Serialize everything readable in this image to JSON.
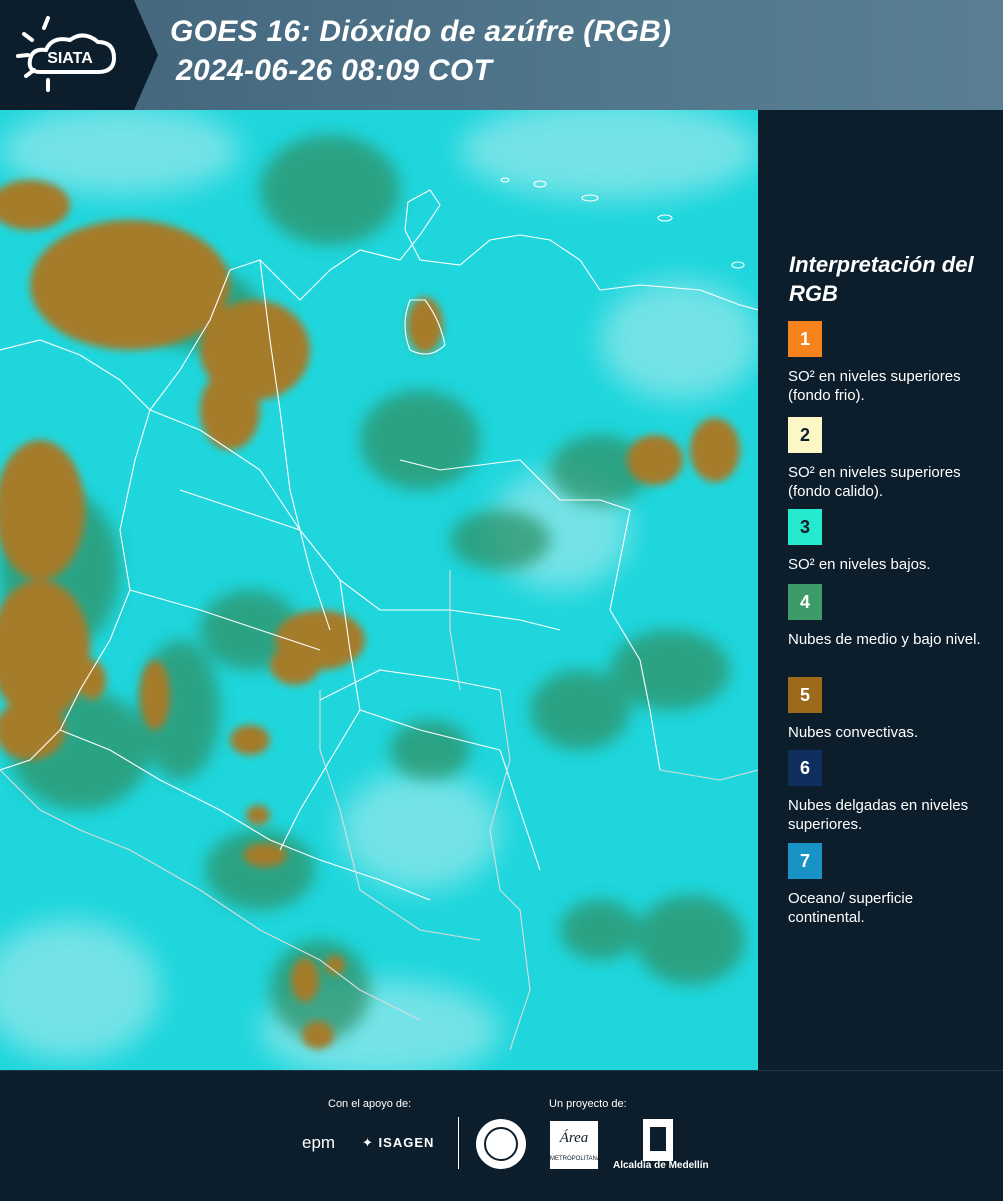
{
  "header": {
    "brand": "SIATA",
    "title_line1": "GOES 16: Dióxido de azúfre (RGB)",
    "title_line2": "2024-06-26 08:09 COT"
  },
  "legend": {
    "title": "Interpretación del RGB",
    "items": [
      {
        "number": "1",
        "color": "#f7821c",
        "text": "SO² en niveles superiores (fondo frio)."
      },
      {
        "number": "2",
        "color": "#fdf7c8",
        "text": "SO² en niveles superiores (fondo calido)."
      },
      {
        "number": "3",
        "color": "#26e9cf",
        "text": "SO² en niveles bajos."
      },
      {
        "number": "4",
        "color": "#3d9a69",
        "text": "Nubes de medio y bajo nivel."
      },
      {
        "number": "5",
        "color": "#9b6a1b",
        "text": "Nubes convectivas."
      },
      {
        "number": "6",
        "color": "#0f2f5f",
        "text": "Nubes delgadas en niveles superiores."
      },
      {
        "number": "7",
        "color": "#1993c5",
        "text": "Oceano/ superficie continental."
      }
    ]
  },
  "footer": {
    "support_label": "Con el apoyo de:",
    "project_label": "Un proyecto de:",
    "epm": "epm",
    "isagen": "ISAGEN",
    "area_metro": "Área",
    "area_sub": "METROPOLITANA",
    "alcaldia": "Alcaldía de Medellín"
  },
  "map": {
    "base_color": "#1ed6dc",
    "convective_color": "#a47c2a",
    "lowcloud_color": "#2e9268",
    "haze_color": "#b9eef1",
    "border_color": "#ffffff"
  }
}
